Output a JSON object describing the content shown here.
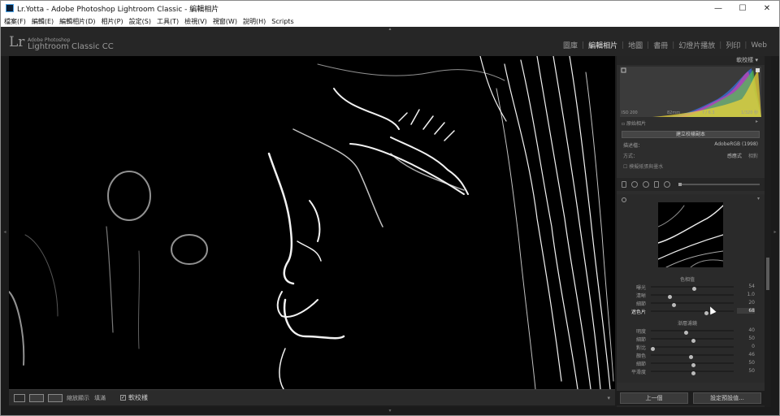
{
  "window": {
    "title": "Lr.Yotta - Adobe Photoshop Lightroom Classic - 編輯相片",
    "buttons": {
      "minimize": "—",
      "maximize": "☐",
      "close": "✕"
    }
  },
  "menu": [
    "檔案(F)",
    "編輯(E)",
    "編輯相片(D)",
    "相片(P)",
    "設定(S)",
    "工具(T)",
    "檢視(V)",
    "視窗(W)",
    "說明(H)",
    "Scripts"
  ],
  "identity": {
    "mark": "Lr",
    "adobe": "Adobe Photoshop",
    "product": "Lightroom Classic CC"
  },
  "modules": [
    {
      "label": "圖庫",
      "active": false
    },
    {
      "label": "編輯相片",
      "active": true
    },
    {
      "label": "地圖",
      "active": false
    },
    {
      "label": "書冊",
      "active": false
    },
    {
      "label": "幻燈片播放",
      "active": false
    },
    {
      "label": "列印",
      "active": false
    },
    {
      "label": "Web",
      "active": false
    }
  ],
  "panel": {
    "header": "軟校樣",
    "histogram_info": {
      "iso": "ISO 200",
      "focal": "82mm",
      "aperture": "f / 6.3",
      "shutter": "1/320 秒"
    },
    "original_photo": "原始相片",
    "create_proof_copy": "建立校樣副本",
    "profile_label": "描述檔：",
    "profile_value": "AdobeRGB (1998)",
    "intent_label": "方式：",
    "intent_value": "感應式",
    "intent_alt": "相對",
    "simulate": "模擬紙張與墨水",
    "section_tone": "色相值",
    "section_color": "漸層濾鏡",
    "sliders_a": [
      {
        "label": "曝光",
        "value": "54",
        "pos": 0.53,
        "on": false
      },
      {
        "label": "清晰",
        "value": "1.0",
        "pos": 0.22,
        "on": false
      },
      {
        "label": "細節",
        "value": "20",
        "pos": 0.27,
        "on": false
      },
      {
        "label": "遮色片",
        "value": "68",
        "pos": 0.68,
        "on": true
      }
    ],
    "sliders_b": [
      {
        "label": "明度",
        "value": "40",
        "pos": 0.42,
        "on": false
      },
      {
        "label": "細節",
        "value": "50",
        "pos": 0.52,
        "on": false
      },
      {
        "label": "對比",
        "value": "0",
        "pos": 0.0,
        "on": false
      },
      {
        "label": "顏色",
        "value": "46",
        "pos": 0.48,
        "on": false
      },
      {
        "label": "細節",
        "value": "50",
        "pos": 0.52,
        "on": false
      },
      {
        "label": "平滑度",
        "value": "50",
        "pos": 0.52,
        "on": false
      }
    ],
    "bottom_section": "鏡頭校正",
    "buttons": {
      "previous": "上一個",
      "reset": "設定預設值..."
    }
  },
  "toolbar": {
    "view_options": "縮放顯示",
    "fill": "填滿",
    "soft_proof": "軟校樣"
  }
}
